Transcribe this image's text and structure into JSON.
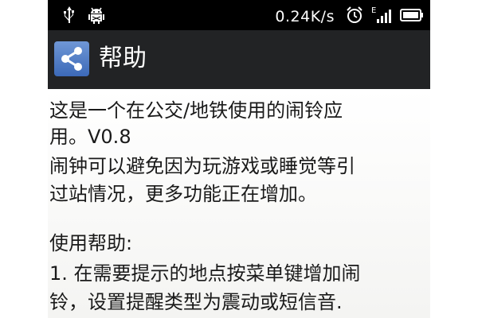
{
  "status_bar": {
    "network_speed": "0.24K/s",
    "signal_type": "E",
    "icons": [
      "usb-icon",
      "android-debug-icon",
      "alarm-clock-icon",
      "signal-bars-icon",
      "battery-icon"
    ]
  },
  "action_bar": {
    "title": "帮助",
    "icon": "share-icon"
  },
  "content": {
    "lines": [
      "这是一个在公交/地铁使用的闹铃应",
      "用。V0.8",
      " 闹钟可以避免因为玩游戏或睡觉等引",
      "过站情况，更多功能正在增加。",
      "使用帮助:",
      " 1. 在需要提示的地点按菜单键增加闹",
      "铃，设置提醒类型为震动或短信音."
    ]
  },
  "colors": {
    "status_bar_bg": "#000000",
    "action_bar_bg": "#222325",
    "app_icon_bg": "#4f7bc6",
    "content_bg": "#ffffff",
    "text": "#1a1a1a"
  }
}
